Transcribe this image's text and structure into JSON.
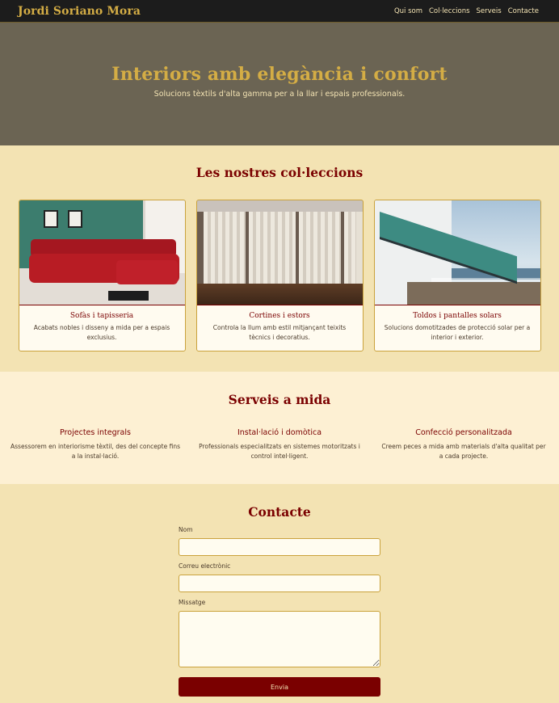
{
  "header": {
    "brand": "Jordi Soriano Mora",
    "nav": [
      "Qui som",
      "Col·leccions",
      "Serveis",
      "Contacte"
    ]
  },
  "hero": {
    "title": "Interiors amb elegància i confort",
    "subtitle": "Solucions tèxtils d'alta gamma per a la llar i espais professionals."
  },
  "collections": {
    "title": "Les nostres col·leccions",
    "items": [
      {
        "title": "Sofàs i tapisseria",
        "text": "Acabats nobles i disseny a mida per a espais exclusius.",
        "image": "red-sofa-photo"
      },
      {
        "title": "Cortines i estors",
        "text": "Controla la llum amb estil mitjançant teixits tècnics i decoratius.",
        "image": "sheer-curtains-photo"
      },
      {
        "title": "Toldos i pantalles solars",
        "text": "Solucions domotitzades de protecció solar per a interior i exterior.",
        "image": "teal-awning-photo"
      }
    ]
  },
  "services": {
    "title": "Serveis a mida",
    "items": [
      {
        "title": "Projectes integrals",
        "text": "Assessorem en interiorisme tèxtil, des del concepte fins a la instal·lació."
      },
      {
        "title": "Instal·lació i domòtica",
        "text": "Professionals especialitzats en sistemes motoritzats i control intel·ligent."
      },
      {
        "title": "Confecció personalitzada",
        "text": "Creem peces a mida amb materials d'alta qualitat per a cada projecte."
      }
    ]
  },
  "contact": {
    "title": "Contacte",
    "name_label": "Nom",
    "email_label": "Correu electrònic",
    "message_label": "Missatge",
    "submit_label": "Envia"
  },
  "colors": {
    "dark": "#1c1c1c",
    "gold": "#d4ad45",
    "burgundy": "#7a0000",
    "cream": "#f3e3b3",
    "hero_bg": "#6b6453"
  }
}
